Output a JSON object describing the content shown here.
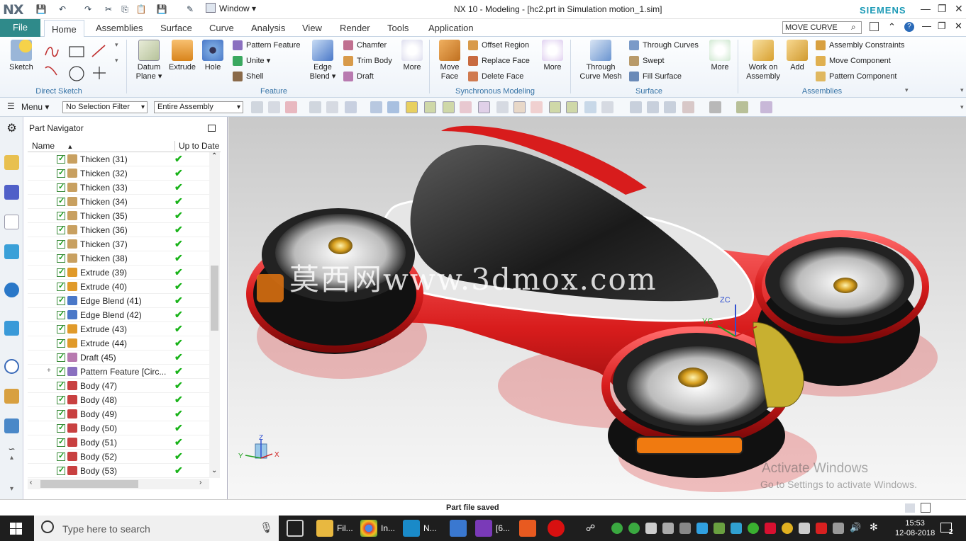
{
  "titlebar": {
    "logo": "NX",
    "window_menu": "Window ▾",
    "title": "NX 10 - Modeling - [hc2.prt in Simulation motion_1.sim]",
    "brand": "SIEMENS"
  },
  "tabs": {
    "file": "File",
    "items": [
      "Home",
      "Assemblies",
      "Surface",
      "Curve",
      "Analysis",
      "View",
      "Render",
      "Tools",
      "Application"
    ],
    "active": "Home",
    "command_search": "MOVE CURVE"
  },
  "ribbon": {
    "sketch": "Sketch",
    "direct_sketch": "Direct Sketch",
    "datum_plane": "Datum Plane ▾",
    "extrude": "Extrude",
    "hole": "Hole",
    "pattern_feature": "Pattern Feature",
    "unite": "Unite ▾",
    "shell": "Shell",
    "edge_blend": "Edge Blend ▾",
    "chamfer": "Chamfer",
    "trim_body": "Trim Body",
    "draft": "Draft",
    "more": "More",
    "feature": "Feature",
    "move_face": "Move Face",
    "offset_region": "Offset Region",
    "replace_face": "Replace Face",
    "delete_face": "Delete Face",
    "sync": "Synchronous Modeling",
    "through_curve_mesh": "Through Curve Mesh",
    "through_curves": "Through Curves",
    "swept": "Swept",
    "fill_surface": "Fill Surface",
    "surface": "Surface",
    "work_on_assembly": "Work on Assembly",
    "add": "Add",
    "assembly_constraints": "Assembly Constraints",
    "move_component": "Move Component",
    "pattern_component": "Pattern Component",
    "assemblies": "Assemblies"
  },
  "toolbar2": {
    "menu": "Menu ▾",
    "selection_filter": "No Selection Filter",
    "scope": "Entire Assembly"
  },
  "navigator": {
    "title": "Part Navigator",
    "col_name": "Name",
    "col_uptodate": "Up to Date",
    "rows": [
      {
        "label": "Thicken (31)",
        "icon": "thicken",
        "color": "#c8a060"
      },
      {
        "label": "Thicken (32)",
        "icon": "thicken",
        "color": "#c8a060"
      },
      {
        "label": "Thicken (33)",
        "icon": "thicken",
        "color": "#c8a060"
      },
      {
        "label": "Thicken (34)",
        "icon": "thicken",
        "color": "#c8a060"
      },
      {
        "label": "Thicken (35)",
        "icon": "thicken",
        "color": "#c8a060"
      },
      {
        "label": "Thicken (36)",
        "icon": "thicken",
        "color": "#c8a060"
      },
      {
        "label": "Thicken (37)",
        "icon": "thicken",
        "color": "#c8a060"
      },
      {
        "label": "Thicken (38)",
        "icon": "thicken",
        "color": "#c8a060"
      },
      {
        "label": "Extrude (39)",
        "icon": "extrude",
        "color": "#e09a2a"
      },
      {
        "label": "Extrude (40)",
        "icon": "extrude",
        "color": "#e09a2a"
      },
      {
        "label": "Edge Blend (41)",
        "icon": "edge-blend",
        "color": "#4a78c8"
      },
      {
        "label": "Edge Blend (42)",
        "icon": "edge-blend",
        "color": "#4a78c8"
      },
      {
        "label": "Extrude (43)",
        "icon": "extrude",
        "color": "#e09a2a"
      },
      {
        "label": "Extrude (44)",
        "icon": "extrude",
        "color": "#e09a2a"
      },
      {
        "label": "Draft (45)",
        "icon": "draft",
        "color": "#b87ab0"
      },
      {
        "label": "Pattern Feature [Circ...",
        "icon": "pattern",
        "color": "#8a70c0",
        "expand": "+"
      },
      {
        "label": "Body (47)",
        "icon": "body",
        "color": "#c84040"
      },
      {
        "label": "Body (48)",
        "icon": "body",
        "color": "#c84040"
      },
      {
        "label": "Body (49)",
        "icon": "body",
        "color": "#c84040"
      },
      {
        "label": "Body (50)",
        "icon": "body",
        "color": "#c84040"
      },
      {
        "label": "Body (51)",
        "icon": "body",
        "color": "#c84040"
      },
      {
        "label": "Body (52)",
        "icon": "body",
        "color": "#c84040"
      },
      {
        "label": "Body (53)",
        "icon": "body",
        "color": "#c84040"
      }
    ]
  },
  "viewport": {
    "watermark": "莫西网www.3dmox.com",
    "activate_title": "Activate Windows",
    "activate_sub": "Go to Settings to activate Windows.",
    "axis_zc": "ZC",
    "axis_yc": "YC",
    "triad_z": "Z",
    "triad_y": "Y",
    "triad_x": "X"
  },
  "status": {
    "text": "Part file saved"
  },
  "taskbar": {
    "search": "Type here to search",
    "apps": [
      "Fil...",
      "In...",
      "N...",
      "[6..."
    ],
    "time": "15:53",
    "date": "12-08-2018",
    "notif": "2"
  }
}
